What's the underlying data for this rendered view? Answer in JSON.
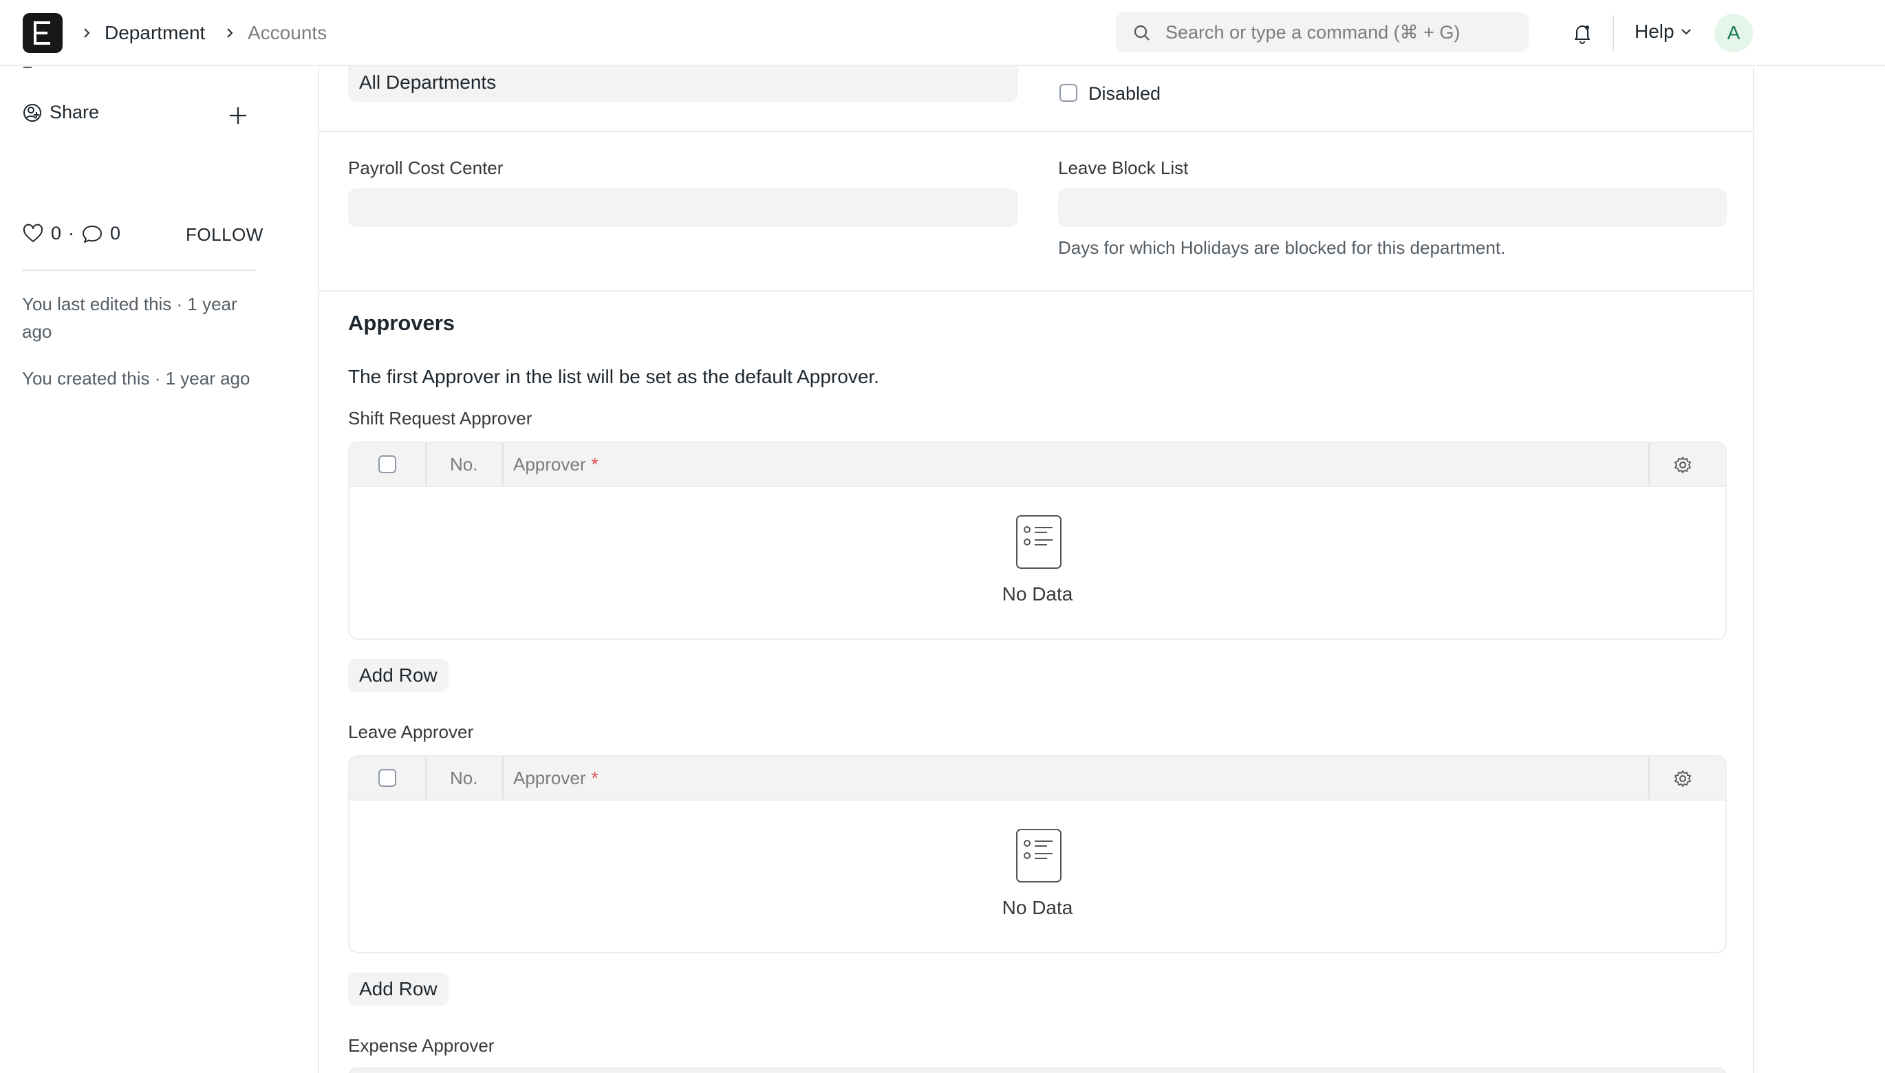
{
  "app": {
    "logo_letter": "E"
  },
  "breadcrumb": {
    "items": [
      "Department",
      "Accounts"
    ]
  },
  "search": {
    "placeholder": "Search or type a command (⌘ + G)"
  },
  "header": {
    "help_label": "Help",
    "avatar_initial": "A"
  },
  "sidebar": {
    "share_label": "Share",
    "likes_count": "0",
    "comments_count": "0",
    "follow_label": "FOLLOW",
    "activity": [
      "You last edited this · 1 year ago",
      "You created this · 1 year ago"
    ]
  },
  "form": {
    "parent_department_value": "All Departments",
    "disabled_label": "Disabled",
    "payroll_cost_center_label": "Payroll Cost Center",
    "payroll_cost_center_value": "",
    "leave_block_list_label": "Leave Block List",
    "leave_block_list_value": "",
    "leave_block_list_description": "Days for which Holidays are blocked for this department.",
    "approvers_section_title": "Approvers",
    "approvers_intro": "The first Approver in the list will be set as the default Approver."
  },
  "tables": [
    {
      "label": "Shift Request Approver",
      "columns": [
        "No.",
        "Approver"
      ],
      "empty_text": "No Data",
      "add_row_label": "Add Row"
    },
    {
      "label": "Leave Approver",
      "columns": [
        "No.",
        "Approver"
      ],
      "empty_text": "No Data",
      "add_row_label": "Add Row"
    }
  ],
  "next_table_label": "Expense Approver",
  "required_marker": "*",
  "icons": {
    "search": "search-icon",
    "bell": "bell-icon",
    "chevron": "chevron-down-icon",
    "share": "share-icon",
    "plus": "plus-icon",
    "heart": "heart-icon",
    "comment": "comment-icon",
    "gear": "gear-icon",
    "empty": "empty-list-icon"
  },
  "colors": {
    "accent_avatar_bg": "#e4f5e9",
    "accent_avatar_fg": "#16794c",
    "required": "#e24c4c"
  }
}
